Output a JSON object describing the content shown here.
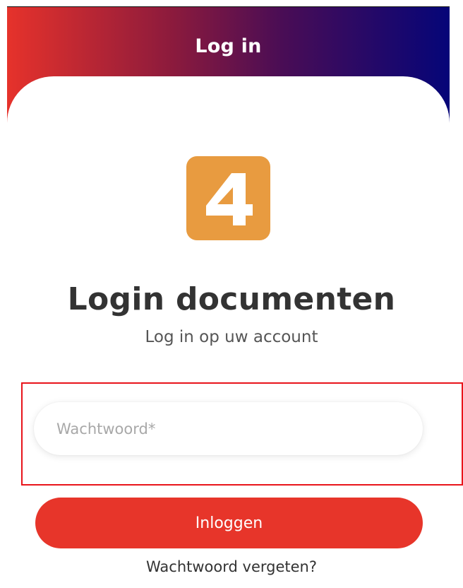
{
  "header": {
    "title": "Log in"
  },
  "logo": {
    "glyph": "4",
    "icon": "app-logo-4-icon",
    "color": "#e89b40"
  },
  "main": {
    "title": "Login documenten",
    "subtitle": "Log in op uw account"
  },
  "form": {
    "password_placeholder": "Wachtwoord*",
    "password_value": "",
    "submit_label": "Inloggen",
    "forgot_label": "Wachtwoord vergeten?"
  },
  "colors": {
    "gradient_start": "#e6322b",
    "gradient_end": "#050578",
    "accent": "#e7352a",
    "highlight": "#e8141b"
  }
}
